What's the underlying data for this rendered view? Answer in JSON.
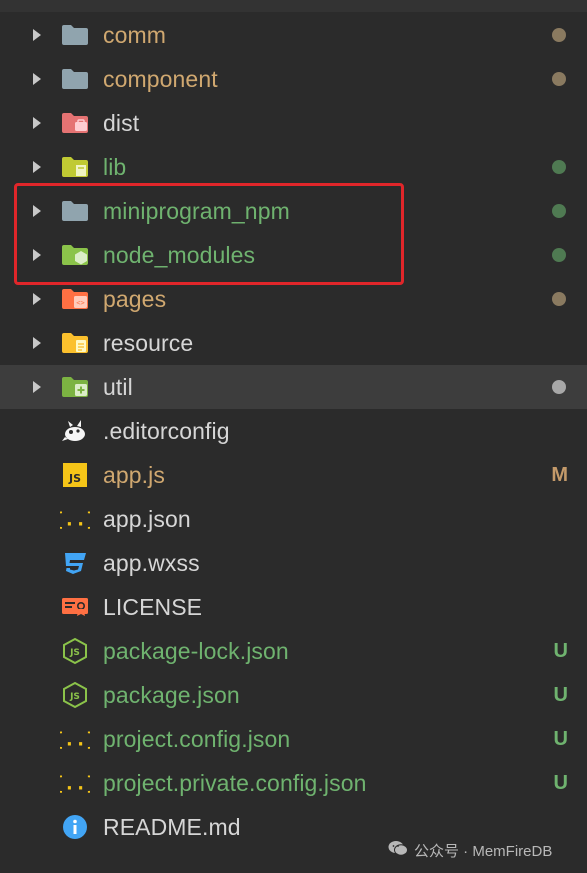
{
  "explorer": {
    "items": [
      {
        "label": "comm",
        "type": "folder",
        "icon": "folder-icon",
        "color": "#d0a870",
        "status": "dot",
        "status_color": "#8a7a60"
      },
      {
        "label": "component",
        "type": "folder",
        "icon": "folder-icon",
        "color": "#d0a870",
        "status": "dot",
        "status_color": "#8a7a60"
      },
      {
        "label": "dist",
        "type": "folder",
        "icon": "folder-dist-icon",
        "color": "#d6d6d6",
        "status": "",
        "status_color": ""
      },
      {
        "label": "lib",
        "type": "folder",
        "icon": "folder-lib-icon",
        "color": "#6fb36f",
        "status": "dot",
        "status_color": "#4f7a52"
      },
      {
        "label": "miniprogram_npm",
        "type": "folder",
        "icon": "folder-icon",
        "color": "#6fb36f",
        "status": "dot",
        "status_color": "#4f7a52"
      },
      {
        "label": "node_modules",
        "type": "folder",
        "icon": "folder-node-icon",
        "color": "#6fb36f",
        "status": "dot",
        "status_color": "#4f7a52"
      },
      {
        "label": "pages",
        "type": "folder",
        "icon": "folder-pages-icon",
        "color": "#d0a870",
        "status": "dot",
        "status_color": "#8a7a60"
      },
      {
        "label": "resource",
        "type": "folder",
        "icon": "folder-resource-icon",
        "color": "#d6d6d6",
        "status": "",
        "status_color": ""
      },
      {
        "label": "util",
        "type": "folder",
        "icon": "folder-util-icon",
        "color": "#d6d6d6",
        "status": "dot",
        "status_color": "#a8a8a8",
        "selected": true
      },
      {
        "label": ".editorconfig",
        "type": "file",
        "icon": "editorconfig-icon",
        "color": "#d6d6d6",
        "status": "",
        "status_color": ""
      },
      {
        "label": "app.js",
        "type": "file",
        "icon": "js-file-icon",
        "color": "#d0a870",
        "status": "M",
        "status_color": "#c49a6a"
      },
      {
        "label": "app.json",
        "type": "file",
        "icon": "json-file-icon",
        "color": "#d6d6d6",
        "status": "",
        "status_color": ""
      },
      {
        "label": "app.wxss",
        "type": "file",
        "icon": "css-file-icon",
        "color": "#d6d6d6",
        "status": "",
        "status_color": ""
      },
      {
        "label": "LICENSE",
        "type": "file",
        "icon": "license-icon",
        "color": "#d6d6d6",
        "status": "",
        "status_color": ""
      },
      {
        "label": "package-lock.json",
        "type": "file",
        "icon": "nodejs-file-icon",
        "color": "#6fb36f",
        "status": "U",
        "status_color": "#6fb36f"
      },
      {
        "label": "package.json",
        "type": "file",
        "icon": "nodejs-file-icon",
        "color": "#6fb36f",
        "status": "U",
        "status_color": "#6fb36f"
      },
      {
        "label": "project.config.json",
        "type": "file",
        "icon": "json-file-icon",
        "color": "#6fb36f",
        "status": "U",
        "status_color": "#6fb36f"
      },
      {
        "label": "project.private.config.json",
        "type": "file",
        "icon": "json-file-icon",
        "color": "#6fb36f",
        "status": "U",
        "status_color": "#6fb36f"
      },
      {
        "label": "README.md",
        "type": "file",
        "icon": "info-icon",
        "color": "#d6d6d6",
        "status": "",
        "status_color": ""
      }
    ]
  },
  "watermark": {
    "text": "公众号 · MemFireDB",
    "icon": "wechat-icon"
  },
  "colors": {
    "background": "#2b2b2b",
    "selected_row": "#3d3d3d",
    "highlight_box": "#e0262a"
  }
}
